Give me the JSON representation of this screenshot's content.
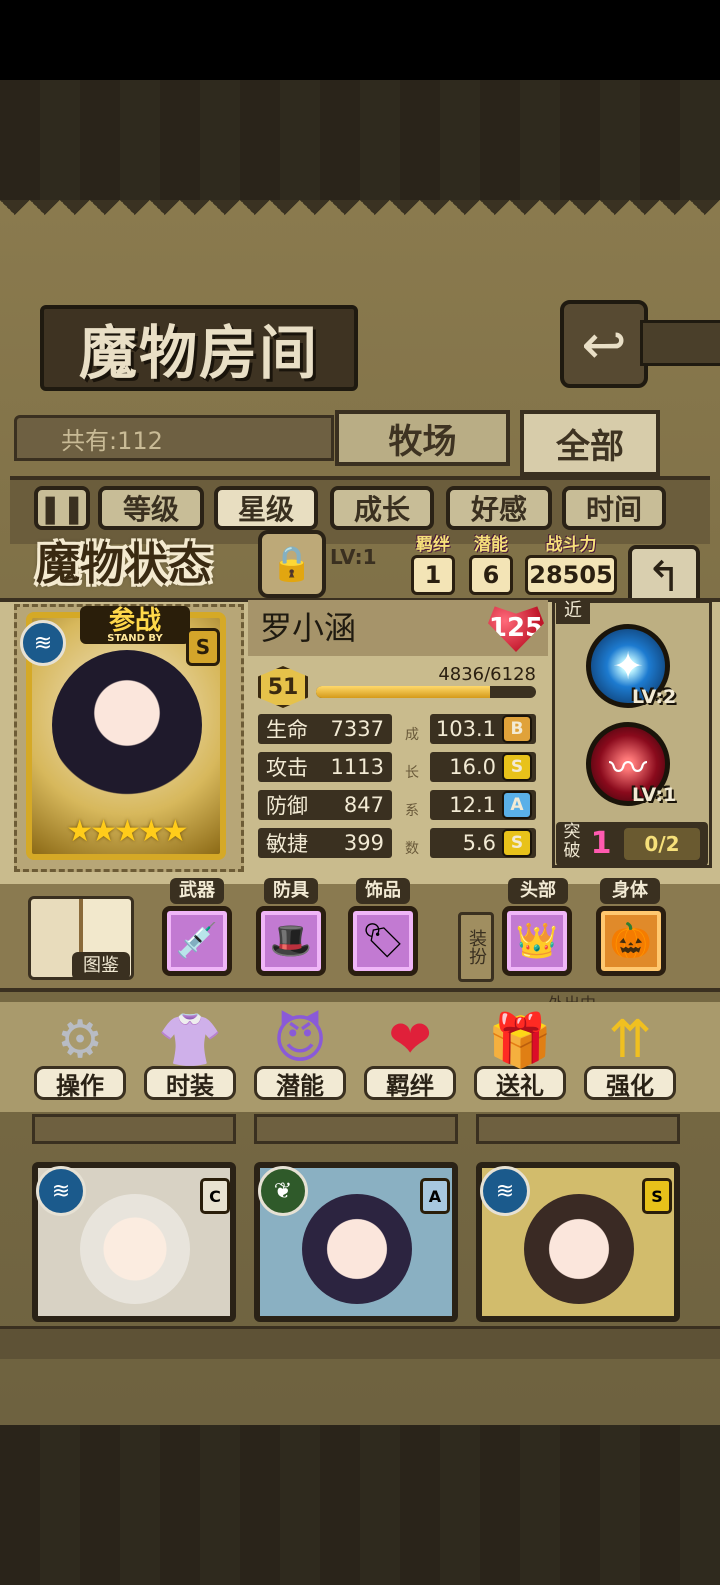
{
  "room": {
    "title": "魔物房间",
    "back_icon": "return-icon",
    "count_text": "共有:112",
    "tabs": [
      {
        "label": "牧场"
      },
      {
        "label": "全部"
      }
    ]
  },
  "sort": {
    "toggle_icon": "pause-icon",
    "options": [
      {
        "label": "等级"
      },
      {
        "label": "星级"
      },
      {
        "label": "成长"
      },
      {
        "label": "好感"
      },
      {
        "label": "时间"
      }
    ],
    "active": "星级"
  },
  "status": {
    "title": "魔物状态",
    "lock_icon": "lock-icon",
    "level_tag": "LV:1",
    "bond": {
      "label": "羁绊",
      "value": "1"
    },
    "potential": {
      "label": "潜能",
      "value": "6"
    },
    "power": {
      "label": "战斗力",
      "value": "28505"
    },
    "back_icon": "return-icon"
  },
  "monster": {
    "name": "罗小涵",
    "affection": "125",
    "standby": "参战",
    "standby_sub": "STAND BY",
    "element_icon": "water-icon",
    "grade": "S",
    "stars": "★★★★★",
    "level": "51",
    "exp_text": "4836/6128",
    "exp_fraction": 0.789,
    "stats": [
      {
        "label": "生命",
        "value": "7337"
      },
      {
        "label": "攻击",
        "value": "1113"
      },
      {
        "label": "防御",
        "value": "847"
      },
      {
        "label": "敏捷",
        "value": "399"
      }
    ],
    "growth_label_chars": [
      "成",
      "长",
      "系",
      "数"
    ],
    "growth": [
      {
        "value": "103.1",
        "grade": "B",
        "color": "#e0a23a"
      },
      {
        "value": "16.0",
        "grade": "S",
        "color": "#e8c21a"
      },
      {
        "value": "12.1",
        "grade": "A",
        "color": "#5ab0e8"
      },
      {
        "value": "5.6",
        "grade": "S",
        "color": "#e8c21a"
      }
    ]
  },
  "skills": {
    "tag": "近",
    "list": [
      {
        "icon": "cross-slash-icon",
        "level": "LV:2"
      },
      {
        "icon": "heartbeat-icon",
        "level": "LV:1"
      }
    ],
    "breakthrough": {
      "label": "突破",
      "value": "1",
      "progress": "0/2"
    }
  },
  "equipment": {
    "book_label": "图鉴",
    "dress_label": "装扮",
    "slots": [
      {
        "label": "武器",
        "icon": "syringe-icon"
      },
      {
        "label": "防具",
        "icon": "hat-icon"
      },
      {
        "label": "饰品",
        "icon": "tag-icon"
      },
      {
        "label": "头部",
        "icon": "crown-icon"
      },
      {
        "label": "身体",
        "icon": "pumpkin-icon"
      }
    ],
    "outside_label": "外出中"
  },
  "actions": [
    {
      "label": "操作",
      "icon": "gear-icon"
    },
    {
      "label": "时装",
      "icon": "outfit-icon"
    },
    {
      "label": "潜能",
      "icon": "demon-icon"
    },
    {
      "label": "羁绊",
      "icon": "hearts-icon"
    },
    {
      "label": "送礼",
      "icon": "gift-icon"
    },
    {
      "label": "强化",
      "icon": "arrows-up-icon"
    }
  ],
  "cards": [
    {
      "grade": "C",
      "element_icon": "water-icon",
      "color": "#d8d2c4"
    },
    {
      "grade": "A",
      "element_icon": "leaf-icon",
      "color": "#8ab0c2"
    },
    {
      "grade": "S",
      "element_icon": "water-icon",
      "color": "#d2bc6c"
    }
  ]
}
